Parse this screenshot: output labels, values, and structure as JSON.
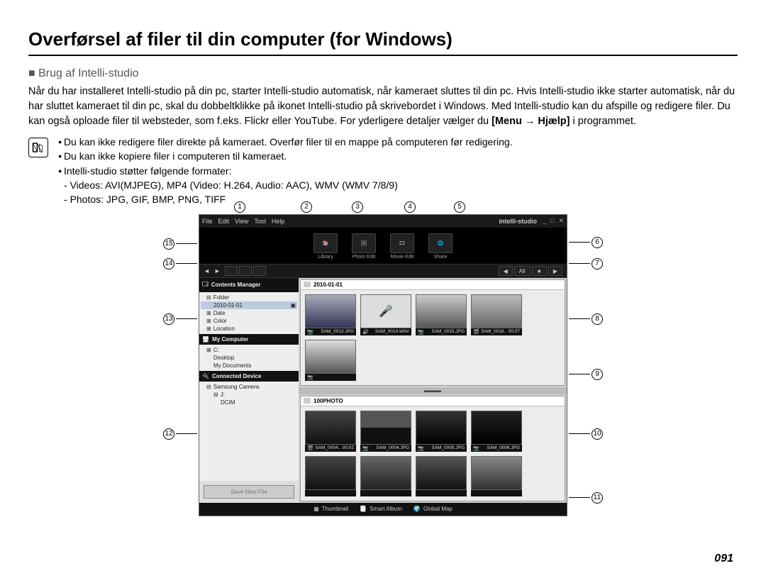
{
  "page_title": "Overførsel af filer til din computer (for Windows)",
  "section_heading": "■ Brug af Intelli-studio",
  "paragraph": "Når du har installeret Intelli-studio på din pc, starter Intelli-studio automatisk, når kameraet sluttes til din pc. Hvis Intelli-studio ikke starter automatisk, når du har sluttet kameraet til din pc, skal du dobbeltklikke på ikonet Intelli-studio på skrivebordet i Windows. Med Intelli-studio kan du afspille og redigere filer. Du kan også oploade filer til websteder, som f.eks. Flickr eller YouTube. For yderligere detaljer vælger du ",
  "menu_path": "[Menu → Hjælp]",
  "paragraph_tail": " i programmet.",
  "notes": {
    "bullet1": "Du kan ikke redigere filer direkte på kameraet. Overfør filer til en mappe på computeren før redigering.",
    "bullet2": "Du kan ikke kopiere filer i computeren til kameraet.",
    "bullet3": "Intelli-studio støtter følgende formater:",
    "sub1": "Videos: AVI(MJPEG), MP4 (Video: H.264, Audio: AAC), WMV (WMV 7/8/9)",
    "sub2": "Photos: JPG, GIF, BMP, PNG, TIFF"
  },
  "app": {
    "menus": [
      "File",
      "Edit",
      "View",
      "Tool",
      "Help"
    ],
    "brand": "intelli-studio",
    "cats": [
      {
        "label": "Library"
      },
      {
        "label": "Photo Edit"
      },
      {
        "label": "Movie Edit"
      },
      {
        "label": "Share"
      }
    ],
    "filters": [
      "All",
      "★"
    ],
    "sidebar": {
      "s1": "Contents Manager",
      "s1_items": [
        "Folder",
        "2010-01-01",
        "Date",
        "Color",
        "Location"
      ],
      "s2": "My Computer",
      "s2_items": [
        "C:",
        "Desktop",
        "My Documents"
      ],
      "s3": "Connected Device",
      "s3_items": [
        "Samsung Camera",
        "J:",
        "DCIM"
      ],
      "save_btn": "Save New File"
    },
    "panel1": {
      "title": "2010-01-01",
      "thumbs": [
        {
          "name": "SAM_0013.JPG"
        },
        {
          "name": "SAM_0014.WAV"
        },
        {
          "name": "SAM_0015.JPG"
        },
        {
          "name": "SAM_0016..",
          "dur": "00:07"
        },
        {
          "name": ""
        }
      ]
    },
    "panel2": {
      "title": "100PHOTO",
      "thumbs": [
        {
          "name": "SAM_0004..",
          "dur": "00:02"
        },
        {
          "name": "SAM_0004.JPG"
        },
        {
          "name": "SAM_0005.JPG"
        },
        {
          "name": "SAM_0006.JPG"
        },
        {
          "name": ""
        },
        {
          "name": ""
        },
        {
          "name": ""
        },
        {
          "name": ""
        }
      ]
    },
    "bottom_tabs": [
      "Thumbnail",
      "Smart Album",
      "Global Map"
    ]
  },
  "callouts": [
    "1",
    "2",
    "3",
    "4",
    "5",
    "6",
    "7",
    "8",
    "9",
    "10",
    "11",
    "12",
    "13",
    "14",
    "15"
  ],
  "page_number": "091"
}
